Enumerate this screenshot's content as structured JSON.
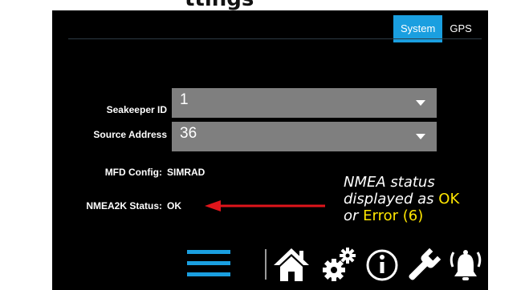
{
  "header": {
    "title": "ttings"
  },
  "tabs": [
    {
      "label": "System",
      "active": true
    },
    {
      "label": "GPS",
      "active": false
    }
  ],
  "fields": {
    "seakeeper_id": {
      "label": "Seakeeper ID",
      "value": "1"
    },
    "source_address": {
      "label": "Source Address",
      "value": "36"
    }
  },
  "info": {
    "mfd_config": {
      "label": "MFD Config:",
      "value": "SIMRAD"
    },
    "nmea2k_status": {
      "label": "NMEA2K Status:",
      "value": "OK"
    }
  },
  "annotation": {
    "line1": "NMEA status",
    "line2_prefix": "displayed as",
    "ok": "OK",
    "line3_prefix": "or",
    "error": "Error (6)"
  },
  "bottom_bar": {
    "icons": [
      "menu-icon",
      "home-icon",
      "settings-gears-icon",
      "info-icon",
      "wrench-icon",
      "alarm-bell-icon"
    ]
  },
  "colors": {
    "accent": "#1a9fe0",
    "screen_bg": "#000000",
    "select_bg": "#7f7f7f",
    "annotation_highlight": "#ffe600",
    "arrow": "#e0151b"
  }
}
